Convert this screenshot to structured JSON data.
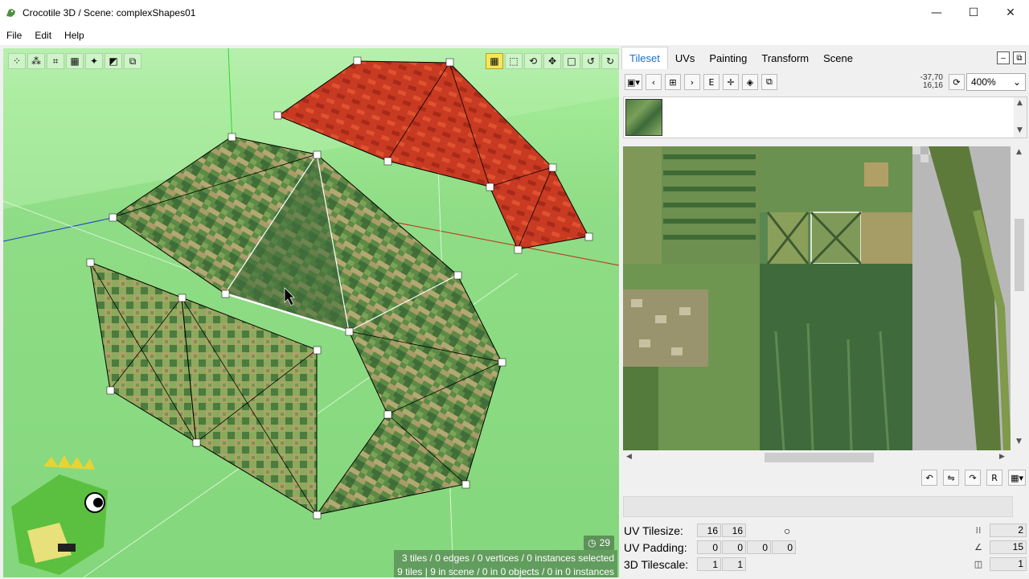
{
  "window": {
    "title": "Crocotile 3D / Scene: complexShapes01",
    "minimize": "—",
    "maximize": "☐",
    "close": "✕"
  },
  "menu": [
    "File",
    "Edit",
    "Help"
  ],
  "viewport": {
    "status_line1": "3 tiles / 0 edges / 0 vertices / 0 instances selected",
    "status_line2": "9 tiles | 9 in scene / 0 in 0 objects / 0 in 0 instances",
    "timer": "29",
    "toolbar_left_icons": [
      "select-vertex-icon",
      "select-edge-icon",
      "select-tile-icon",
      "checker-icon",
      "sparkle-icon",
      "paint-icon",
      "copy-icon"
    ],
    "toolbar_right_icons": [
      "grid-icon",
      "cube-icon",
      "rotate-icon",
      "move-icon",
      "square-icon",
      "undo-icon",
      "redo-icon"
    ]
  },
  "panel": {
    "tabs": [
      "Tileset",
      "UVs",
      "Painting",
      "Transform",
      "Scene"
    ],
    "active_tab": "Tileset",
    "coords_line1": "-37,70",
    "coords_line2": "16,16",
    "zoom": "400%"
  },
  "params": {
    "uv_tilesize_label": "UV Tilesize:",
    "uv_tilesize": [
      "16",
      "16"
    ],
    "uv_padding_label": "UV Padding:",
    "uv_padding": [
      "0",
      "0",
      "0",
      "0"
    ],
    "tilescale_label": "3D Tilescale:",
    "tilescale": [
      "1",
      "1"
    ],
    "right_values": [
      "2",
      "15",
      "1"
    ]
  },
  "colors": {
    "accent": "#1a6fc9",
    "selection_yellow": "#f5e65a"
  }
}
